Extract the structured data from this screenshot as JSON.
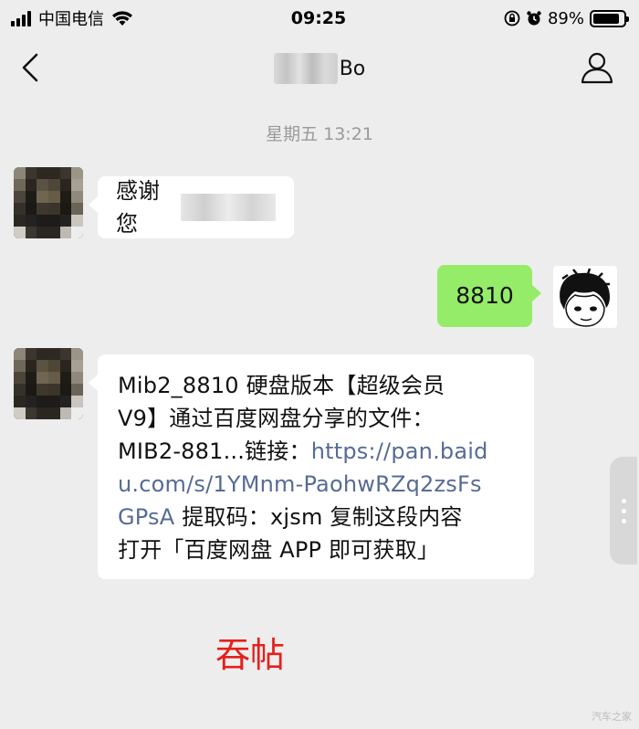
{
  "status_bar": {
    "carrier": "中国电信",
    "time": "09:25",
    "battery_percent_text": "89%",
    "battery_level": 0.89
  },
  "nav": {
    "title_suffix": "Bo"
  },
  "chat": {
    "timestamp": "星期五 13:21",
    "messages": [
      {
        "side": "left",
        "text": "感谢您"
      },
      {
        "side": "right",
        "text": "8810"
      },
      {
        "side": "left",
        "lines": [
          {
            "plain": "Mib2_8810 硬盘版本【超级会员"
          },
          {
            "plain": "V9】通过百度网盘分享的文件："
          },
          {
            "plain": "MIB2-881...链接：",
            "link": "https://pan.baid"
          },
          {
            "link": "u.com/s/1YMnm-PaohwRZq2zsFs"
          },
          {
            "link": "GPsA",
            "plain_after": " 提取码：xjsm 复制这段内容"
          },
          {
            "plain": "打开「百度网盘 APP 即可获取」"
          }
        ]
      }
    ]
  },
  "annotation": "吞帖",
  "watermark": "汽车之家",
  "colors": {
    "background": "#ededed",
    "bubble_self": "#95ec69",
    "link": "#576b95",
    "annotation": "#e5201b"
  },
  "icons": [
    "back-chevron-icon",
    "profile-icon",
    "wifi-icon",
    "rotation-lock-icon",
    "alarm-icon",
    "battery-icon"
  ]
}
